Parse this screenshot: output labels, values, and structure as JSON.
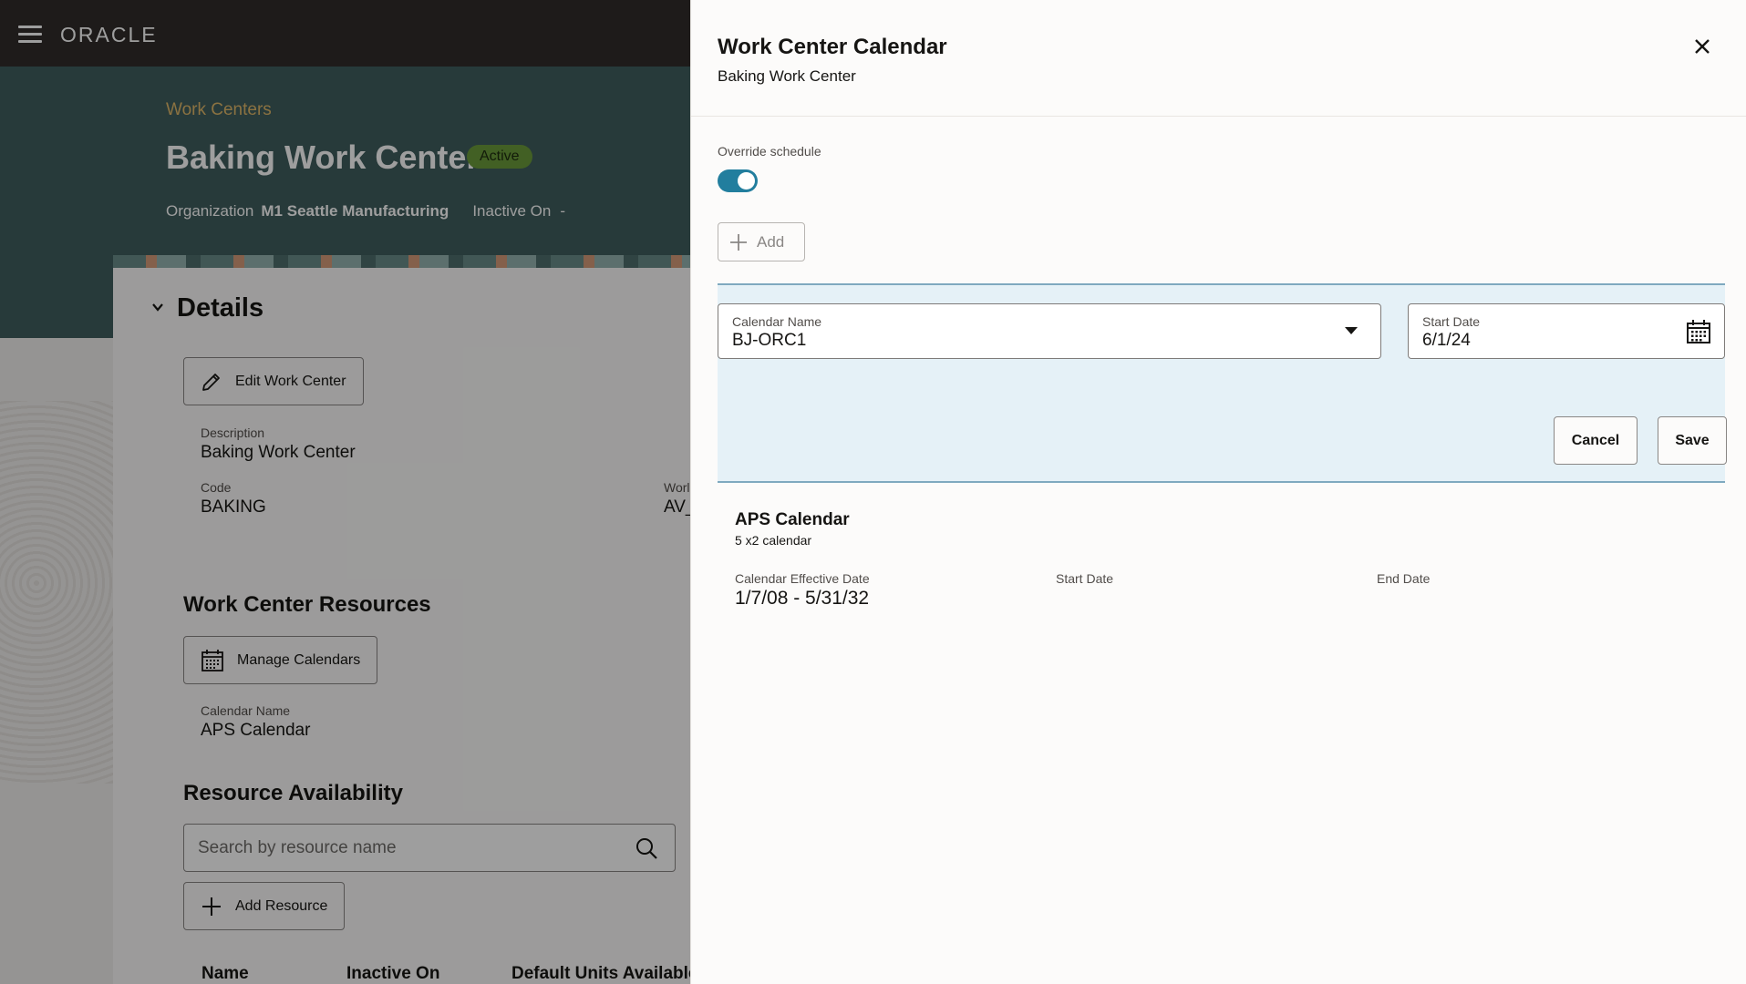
{
  "app": {
    "brand": "ORACLE"
  },
  "page": {
    "breadcrumb": "Work Centers",
    "title": "Baking Work Center",
    "status": "Active",
    "org_label": "Organization",
    "org_value": "M1 Seattle Manufacturing",
    "inactive_label": "Inactive On",
    "inactive_value": "-",
    "details_heading": "Details",
    "edit_button": "Edit Work Center",
    "description_label": "Description",
    "description_value": "Baking Work Center",
    "code_label": "Code",
    "code_value": "BAKING",
    "trunc_label": "Worl",
    "trunc_value": "AV_",
    "resources_heading": "Work Center Resources",
    "manage_calendars_button": "Manage Calendars",
    "calendar_name_label": "Calendar Name",
    "calendar_name_value": "APS Calendar",
    "availability_heading": "Resource Availability",
    "search_placeholder": "Search by resource name",
    "add_resource_button": "Add Resource",
    "columns": [
      "Name",
      "Inactive On",
      "Default Units Available"
    ]
  },
  "drawer": {
    "title": "Work Center Calendar",
    "subtitle": "Baking Work Center",
    "override_label": "Override schedule",
    "override_on": true,
    "add_button": "Add",
    "calendar_name_label": "Calendar Name",
    "calendar_name_value": "BJ-ORC1",
    "start_date_label": "Start Date",
    "start_date_value": "6/1/24",
    "cancel_button": "Cancel",
    "save_button": "Save",
    "current": {
      "name": "APS Calendar",
      "description": "5 x2 calendar",
      "effective_label": "Calendar Effective Date",
      "effective_value": "1/7/08 - 5/31/32",
      "start_label": "Start Date",
      "end_label": "End Date"
    }
  },
  "colors": {
    "topbar": "#312d2a",
    "hero": "#3f5e5e",
    "accent_gold": "#e1b86a",
    "active_badge": "#6b9c3a",
    "toggle_on": "#227e9e",
    "edit_panel": "#e5f1f7"
  }
}
